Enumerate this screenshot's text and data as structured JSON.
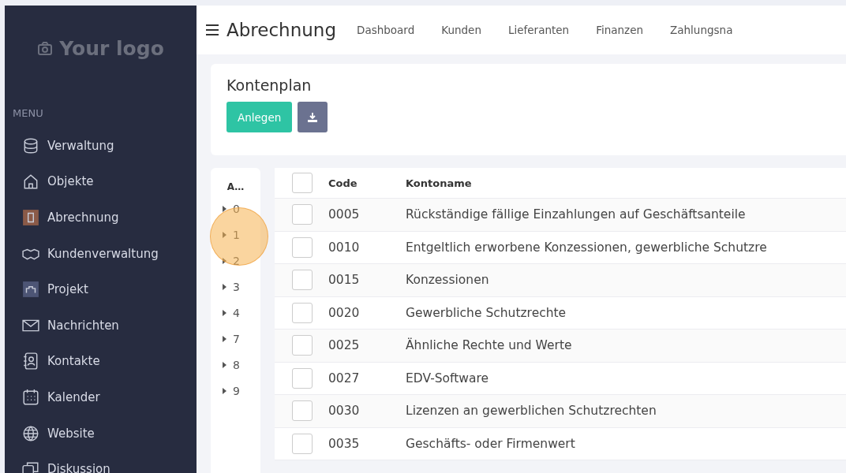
{
  "sidebar": {
    "logo": "Your logo",
    "menu_label": "MENU",
    "items": [
      {
        "label": "Verwaltung"
      },
      {
        "label": "Objekte"
      },
      {
        "label": "Abrechnung"
      },
      {
        "label": "Kundenverwaltung"
      },
      {
        "label": "Projekt"
      },
      {
        "label": "Nachrichten"
      },
      {
        "label": "Kontakte"
      },
      {
        "label": "Kalender"
      },
      {
        "label": "Website"
      },
      {
        "label": "Diskussion"
      }
    ]
  },
  "topbar": {
    "title": "Abrechnung",
    "nav": [
      "Dashboard",
      "Kunden",
      "Lieferanten",
      "Finanzen",
      "Zahlungsna"
    ]
  },
  "card": {
    "title": "Kontenplan",
    "create_button": "Anlegen"
  },
  "tree": {
    "header": "A…",
    "items": [
      {
        "label": "0",
        "expanded": false
      },
      {
        "label": "1",
        "expanded": false
      },
      {
        "label": "2",
        "expanded": false
      },
      {
        "label": "3",
        "expanded": false
      },
      {
        "label": "4",
        "expanded": false
      },
      {
        "label": "7",
        "expanded": false
      },
      {
        "label": "8",
        "expanded": false
      },
      {
        "label": "9",
        "expanded": false
      }
    ]
  },
  "table": {
    "columns": [
      "Code",
      "Kontoname"
    ],
    "header_checked": false,
    "rows": [
      {
        "code": "0005",
        "name": "Rückständige fällige Einzahlungen auf Geschäftsanteile",
        "checked": false
      },
      {
        "code": "0010",
        "name": "Entgeltlich erworbene Konzessionen, gewerbliche Schutzre",
        "checked": false
      },
      {
        "code": "0015",
        "name": "Konzessionen",
        "checked": false
      },
      {
        "code": "0020",
        "name": "Gewerbliche Schutzrechte",
        "checked": false
      },
      {
        "code": "0025",
        "name": "Ähnliche Rechte und Werte",
        "checked": false
      },
      {
        "code": "0027",
        "name": "EDV-Software",
        "checked": false
      },
      {
        "code": "0030",
        "name": "Lizenzen an gewerblichen Schutzrechten",
        "checked": false
      },
      {
        "code": "0035",
        "name": "Geschäfts- oder Firmenwert",
        "checked": false
      }
    ]
  }
}
